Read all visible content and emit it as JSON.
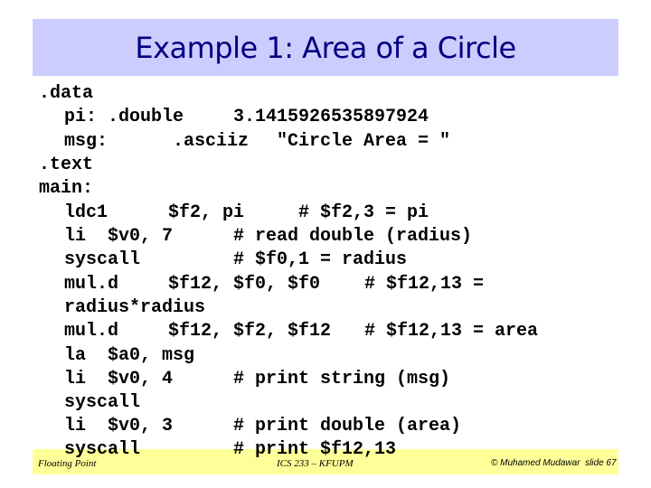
{
  "slide": {
    "title": "Example 1: Area of a Circle",
    "colors": {
      "title_bg": "#ccccff",
      "title_text": "#000080",
      "footer_bg": "#ffff99"
    }
  },
  "code": {
    "lines": [
      {
        "tokens": [
          ".data"
        ]
      },
      {
        "tokens": [
          "pi: .double",
          "3.1415926535897924"
        ]
      },
      {
        "tokens": [
          "msg:",
          ".asciiz",
          "\"Circle Area = \""
        ]
      },
      {
        "tokens": [
          ".text"
        ]
      },
      {
        "tokens": [
          "main:"
        ]
      },
      {
        "tokens": [
          "ldc1",
          "$f2, pi",
          "# $f2,3 = pi"
        ]
      },
      {
        "tokens": [
          "li  $v0, 7",
          "# read double (radius)"
        ]
      },
      {
        "tokens": [
          "syscall",
          "# $f0,1 = radius"
        ]
      },
      {
        "tokens": [
          "mul.d",
          "$f12, $f0, $f0",
          "# $f12,13 ="
        ]
      },
      {
        "tokens": [
          "radius*radius"
        ]
      },
      {
        "tokens": [
          "mul.d",
          "$f12, $f2, $f12",
          "# $f12,13 = area"
        ]
      },
      {
        "tokens": [
          "la  $a0, msg"
        ]
      },
      {
        "tokens": [
          "li  $v0, 4",
          "# print string (msg)"
        ]
      },
      {
        "tokens": [
          "syscall"
        ]
      },
      {
        "tokens": [
          "li  $v0, 3",
          "# print double (area)"
        ]
      },
      {
        "tokens": [
          "syscall",
          "# print $f12,13"
        ]
      }
    ]
  },
  "footer": {
    "left": "Floating Point",
    "center": "ICS 233 – KFUPM",
    "right": "© Muhamed Mudawar  slide 67"
  }
}
